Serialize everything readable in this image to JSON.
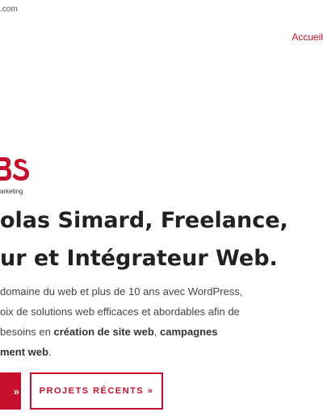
{
  "topbar": {
    "email_fragment": ".com"
  },
  "nav": {
    "home_label": "Accueil"
  },
  "logo": {
    "tagline_fragment": "arketing",
    "brand_color": "#c8102e"
  },
  "hero": {
    "title_line1": "olas Simard, Freelance,",
    "title_line2": "ur et Intégrateur Web.",
    "text_line1": "domaine du web et plus de 10 ans avec WordPress,",
    "text_line2": "oix de solutions web efficaces et abordables afin de",
    "text_line3_pre": "besoins en ",
    "text_line3_bold1": "création de site web",
    "text_line3_mid": ", ",
    "text_line3_bold2": "campagnes",
    "text_line4_bold": "ment web",
    "text_line4_post": "."
  },
  "buttons": {
    "primary_label": "»",
    "secondary_label": "PROJETS RÉCENTS »"
  },
  "colors": {
    "accent": "#c8102e",
    "text": "#333333"
  }
}
